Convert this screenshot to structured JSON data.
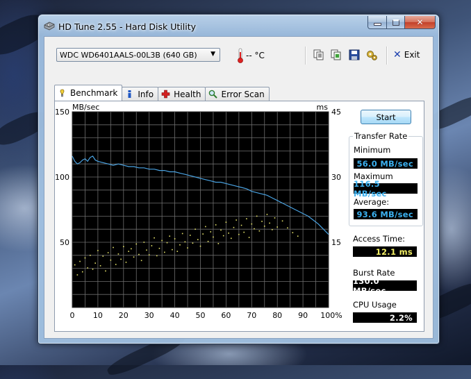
{
  "window": {
    "title": "HD Tune 2.55 - Hard Disk Utility"
  },
  "toolbar": {
    "drive": "WDC WD6401AALS-00L3B (640 GB)",
    "temperature": "-- °C",
    "exit_label": "Exit",
    "icons": [
      "copy-text-icon",
      "copy-image-icon",
      "save-icon",
      "options-icon"
    ]
  },
  "tabs": [
    {
      "label": "Benchmark",
      "icon": "benchmark-icon",
      "active": true
    },
    {
      "label": "Info",
      "icon": "info-icon",
      "active": false
    },
    {
      "label": "Health",
      "icon": "health-icon",
      "active": false
    },
    {
      "label": "Error Scan",
      "icon": "error-scan-icon",
      "active": false
    }
  ],
  "benchmark": {
    "start_label": "Start",
    "transfer_rate": {
      "title": "Transfer Rate",
      "minimum_label": "Minimum",
      "minimum_value": "56.0 MB/sec",
      "maximum_label": "Maximum",
      "maximum_value": "116.5 MB/sec",
      "average_label": "Average:",
      "average_value": "93.6 MB/sec"
    },
    "access_time_label": "Access Time:",
    "access_time_value": "12.1 ms",
    "burst_rate_label": "Burst Rate",
    "burst_rate_value": "130.0 MB/sec",
    "cpu_usage_label": "CPU Usage",
    "cpu_usage_value": "2.2%"
  },
  "colors": {
    "chart_bg": "#000000",
    "grid": "#6e6e6e",
    "transfer_line": "#4aa3e2",
    "access_dots": "#e6e36a",
    "value_blue": "#3bb0ef",
    "value_yellow": "#f4f066"
  },
  "chart_data": {
    "type": "line",
    "title": "",
    "xlabel": "",
    "y_left_label": "MB/sec",
    "y_right_label": "ms",
    "x_ticks": [
      "0",
      "10",
      "20",
      "30",
      "40",
      "50",
      "60",
      "70",
      "80",
      "90",
      "100%"
    ],
    "y_left_ticks": [
      "150",
      "100",
      "50"
    ],
    "y_right_ticks": [
      "45",
      "30",
      "15"
    ],
    "xlim": [
      0,
      100
    ],
    "ylim_left": [
      0,
      150
    ],
    "ylim_right": [
      0,
      45
    ],
    "grid": true,
    "series": [
      {
        "name": "Transfer Rate",
        "axis": "left",
        "x": [
          0,
          1,
          2,
          3,
          4,
          5,
          6,
          7,
          8,
          9,
          10,
          12,
          14,
          16,
          18,
          20,
          22,
          24,
          26,
          28,
          30,
          32,
          34,
          36,
          38,
          40,
          42,
          44,
          46,
          48,
          50,
          52,
          54,
          56,
          58,
          60,
          62,
          64,
          66,
          68,
          70,
          72,
          74,
          76,
          78,
          80,
          82,
          84,
          86,
          88,
          90,
          92,
          94,
          96,
          98,
          100
        ],
        "y": [
          116,
          112,
          110,
          111,
          113,
          114,
          112,
          115,
          116,
          113,
          112,
          111,
          110,
          109,
          110,
          109,
          108,
          108,
          107,
          107,
          106,
          106,
          105,
          105,
          104,
          104,
          103,
          102,
          101,
          100,
          99,
          98,
          97,
          96,
          96,
          95,
          94,
          93,
          92,
          91,
          89,
          88,
          87,
          86,
          84,
          82,
          80,
          78,
          76,
          74,
          72,
          70,
          67,
          64,
          60,
          56
        ]
      },
      {
        "name": "Access Time",
        "axis": "right",
        "type": "scatter",
        "x": [
          1,
          2,
          3,
          4,
          5,
          6,
          7,
          8,
          9,
          10,
          11,
          12,
          13,
          14,
          15,
          16,
          17,
          18,
          19,
          20,
          21,
          22,
          23,
          24,
          25,
          26,
          27,
          28,
          29,
          30,
          31,
          32,
          33,
          34,
          35,
          36,
          37,
          38,
          39,
          40,
          41,
          42,
          43,
          44,
          45,
          46,
          47,
          48,
          49,
          50,
          51,
          52,
          53,
          54,
          55,
          56,
          57,
          58,
          59,
          60,
          61,
          62,
          63,
          64,
          65,
          66,
          67,
          68,
          69,
          70,
          71,
          72,
          73,
          74,
          75,
          76,
          77,
          78,
          79,
          80,
          82,
          84,
          86,
          88
        ],
        "y": [
          9.8,
          7.5,
          10.6,
          8.2,
          11.4,
          9.1,
          12.0,
          8.8,
          10.2,
          13.1,
          9.6,
          11.8,
          8.4,
          12.6,
          10.9,
          13.8,
          9.9,
          12.3,
          11.1,
          14.0,
          10.4,
          12.9,
          13.5,
          11.6,
          14.6,
          12.2,
          10.8,
          15.0,
          13.2,
          12.1,
          14.2,
          16.0,
          11.9,
          13.6,
          15.4,
          12.7,
          14.9,
          16.4,
          13.3,
          15.8,
          12.9,
          14.4,
          17.0,
          15.1,
          13.7,
          16.6,
          14.8,
          18.0,
          15.6,
          14.1,
          16.9,
          18.6,
          15.2,
          17.4,
          16.2,
          19.0,
          14.7,
          17.8,
          16.5,
          19.6,
          17.1,
          15.9,
          18.4,
          20.1,
          16.8,
          18.9,
          17.3,
          20.4,
          16.1,
          19.2,
          18.1,
          21.0,
          17.6,
          19.8,
          18.7,
          21.4,
          19.4,
          17.9,
          20.6,
          18.5,
          19.9,
          18.3,
          17.2,
          16.4
        ]
      }
    ]
  }
}
